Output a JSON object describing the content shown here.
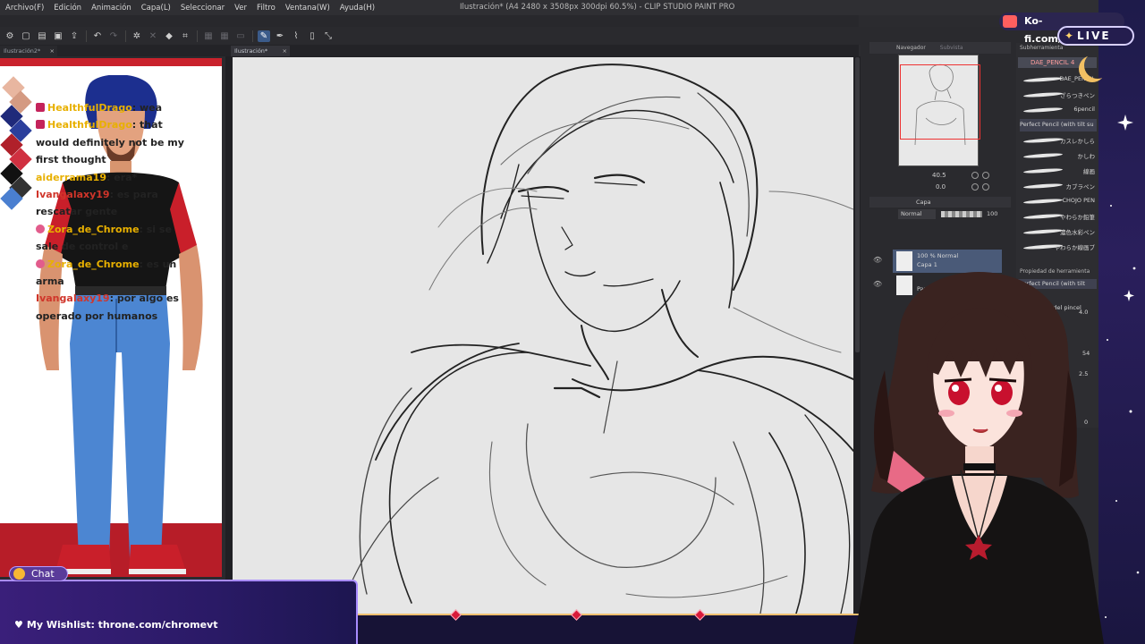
{
  "window": {
    "title": "Ilustración* (A4 2480 x 3508px 300dpi 60.5%) - CLIP STUDIO PAINT PRO",
    "menu": [
      "Archivo(F)",
      "Edición",
      "Animación",
      "Capa(L)",
      "Seleccionar",
      "Ver",
      "Filtro",
      "Ventana(W)",
      "Ayuda(H)"
    ]
  },
  "tabs": [
    {
      "label": "Ilustración2*"
    },
    {
      "label": "Ilustración*"
    }
  ],
  "navigator": {
    "title": "Navegador",
    "subtitle": "Subvista",
    "zoom": "40.5",
    "rotation": "0.0"
  },
  "layers": {
    "title": "Capa",
    "blend_mode": "Normal",
    "opacity": "100",
    "items": [
      {
        "line1": "100 % Normal",
        "line2": "Capa 1"
      },
      {
        "line1": "",
        "line2": "Pap"
      }
    ]
  },
  "brushes": {
    "title": "Subherramienta",
    "selected": "DAE_PENCIL 4",
    "items": [
      {
        "name": "DAE_PENCIL"
      },
      {
        "name": "ざらつきペン"
      },
      {
        "name": "6pencil"
      },
      {
        "name": "Perfect Pencil (with tilt su"
      },
      {
        "name": "カスレかしら"
      },
      {
        "name": "かしわ"
      },
      {
        "name": "線画"
      },
      {
        "name": "カブラペン"
      },
      {
        "name": "CHOJO PEN"
      },
      {
        "name": "やわらか鉛筆"
      },
      {
        "name": "濃色水彩ペン"
      },
      {
        "name": "やわらか線画ブ"
      }
    ],
    "property_title": "Propiedad de herramienta",
    "property_selected": "Perfect Pencil (with tilt supp",
    "property_label": "Tamaño del pincel",
    "values": [
      "4.0",
      "54",
      "2.5",
      "0"
    ]
  },
  "chat": {
    "messages": [
      {
        "user": "HealthfulDrago",
        "text": ": wea"
      },
      {
        "user": "HealthfulDrago",
        "text": ": that"
      },
      {
        "user": "",
        "text": "would definitely not be my"
      },
      {
        "user": "",
        "text": "first thought"
      },
      {
        "user": "aiderrama19",
        "text": ": era*"
      },
      {
        "user": "Ivangalaxy19",
        "text": ": es para"
      },
      {
        "user": "",
        "text": "rescatar gente"
      },
      {
        "user": "Zora_de_Chrome",
        "text": ": si se"
      },
      {
        "user": "",
        "text": "sale de control e"
      },
      {
        "user": "Zora_de_Chrome",
        "text": ": es un"
      },
      {
        "user": "",
        "text": "arma"
      },
      {
        "user": "Ivangalaxy19",
        "text": ": por algo es"
      },
      {
        "user": "",
        "text": "operado por humanos"
      }
    ],
    "label": "Chat"
  },
  "overlay": {
    "kofi": "Ko-fi.com/chromevt",
    "live": "LIVE",
    "wishlist": "My Wishlist: throne.com/chromevt"
  },
  "colors": {
    "accent_red": "#c9222c",
    "panel_bg": "#2a2a2e",
    "frame_purple": "#3a1f7a",
    "frame_gold": "#f0c070"
  },
  "icons": [
    "undo-icon",
    "redo-icon",
    "brush-icon",
    "eye-icon",
    "star-icon",
    "heart-icon",
    "moon-icon",
    "coffee-cup-icon"
  ]
}
